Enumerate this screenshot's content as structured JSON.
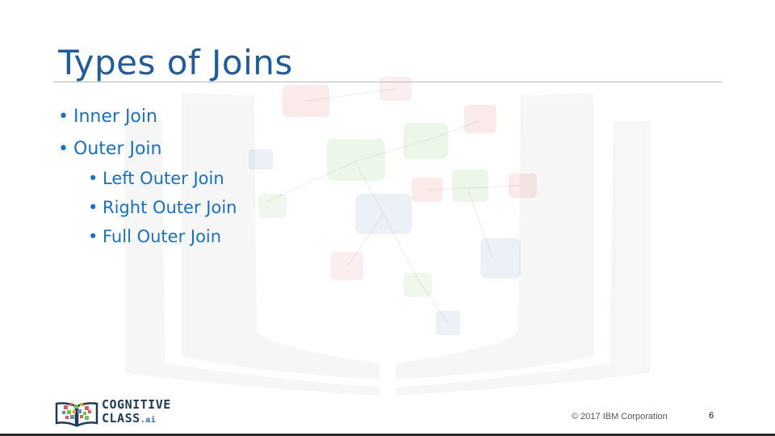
{
  "slide": {
    "title": "Types of Joins",
    "bullets": [
      {
        "level": 1,
        "text": "Inner Join"
      },
      {
        "level": 1,
        "text": "Outer Join"
      },
      {
        "level": 2,
        "text": "Left Outer Join"
      },
      {
        "level": 2,
        "text": "Right Outer Join"
      },
      {
        "level": 2,
        "text": "Full Outer Join"
      }
    ],
    "bullet_glyph": "•"
  },
  "footer": {
    "logo_line1": "COGNITIVE",
    "logo_line2": "CLASS",
    "logo_suffix": ".ai",
    "copyright": "© 2017 IBM Corporation",
    "page_number": "6"
  },
  "colors": {
    "title": "#1f5c99",
    "bullet_text": "#1a70c0",
    "rule": "#b8b8b8",
    "logo": "#1e3a5a"
  },
  "icons": [
    "book-network-watermark-icon",
    "cognitive-class-logo-icon"
  ]
}
